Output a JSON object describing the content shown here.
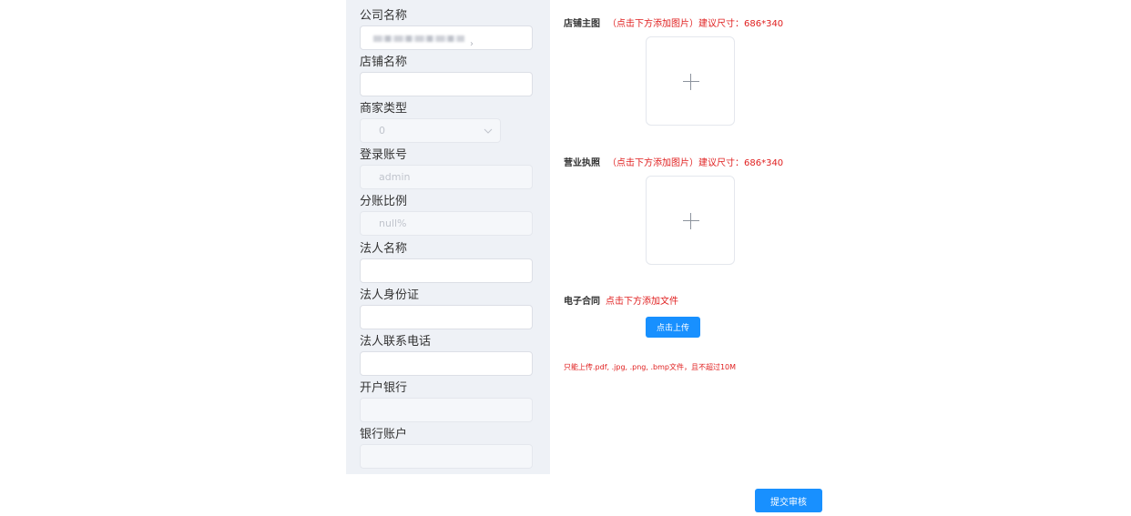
{
  "form": {
    "company_name": {
      "label": "公司名称",
      "value": ""
    },
    "shop_name": {
      "label": "店铺名称",
      "value": ""
    },
    "merchant_type": {
      "label": "商家类型",
      "value": "0"
    },
    "login_account": {
      "label": "登录账号",
      "value": "admin"
    },
    "split_ratio": {
      "label": "分账比例",
      "value": "null%"
    },
    "legal_name": {
      "label": "法人名称",
      "value": ""
    },
    "legal_id": {
      "label": "法人身份证",
      "value": ""
    },
    "legal_phone": {
      "label": "法人联系电话",
      "value": ""
    },
    "bank": {
      "label": "开户银行",
      "value": ""
    },
    "bank_account": {
      "label": "银行账户",
      "value": ""
    }
  },
  "uploads": {
    "shop_image": {
      "label": "店铺主图",
      "hint": "（点击下方添加图片）建议尺寸：686*340"
    },
    "business_license": {
      "label": "营业执照",
      "hint": "（点击下方添加图片）建议尺寸：686*340"
    },
    "contract": {
      "label": "电子合同",
      "hint": "点击下方添加文件",
      "button_label": "点击上传",
      "note": "只能上传.pdf, .jpg, .png, .bmp文件，且不超过10M"
    }
  },
  "submit_label": "提交审核",
  "colors": {
    "primary": "#1890ff",
    "hint": "#e02020",
    "panel": "#eef1f6"
  }
}
